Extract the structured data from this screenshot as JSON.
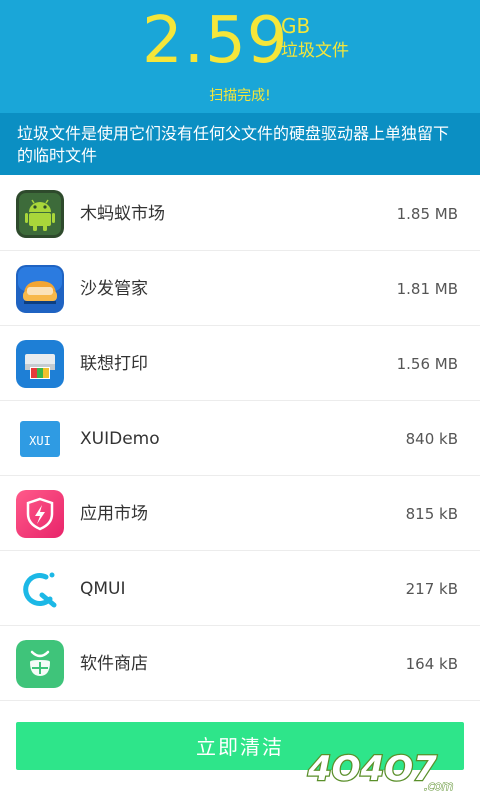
{
  "header": {
    "size_value": "2.59",
    "size_unit": "GB",
    "size_label": "垃圾文件",
    "scan_status": "扫描完成!",
    "description": "垃圾文件是使用它们没有任何父文件的硬盘驱动器上单独留下的临时文件"
  },
  "apps": [
    {
      "name": "木蚂蚁市场",
      "size": "1.85 MB",
      "icon": "android-robot-icon"
    },
    {
      "name": "沙发管家",
      "size": "1.81 MB",
      "icon": "sofa-icon"
    },
    {
      "name": "联想打印",
      "size": "1.56 MB",
      "icon": "printer-icon"
    },
    {
      "name": "XUIDemo",
      "size": "840 kB",
      "icon": "xui-icon"
    },
    {
      "name": "应用市场",
      "size": "815 kB",
      "icon": "shield-bolt-icon"
    },
    {
      "name": "QMUI",
      "size": "217 kB",
      "icon": "qmui-icon"
    },
    {
      "name": "软件商店",
      "size": "164 kB",
      "icon": "leaf-store-icon"
    }
  ],
  "clean_button_label": "立即清洁",
  "watermark_text": "4O4O7.com",
  "colors": {
    "header_bg": "#1aa6d8",
    "desc_bg": "#0b8fc3",
    "accent_yellow": "#f5e63a",
    "button_green": "#2ee58a"
  }
}
